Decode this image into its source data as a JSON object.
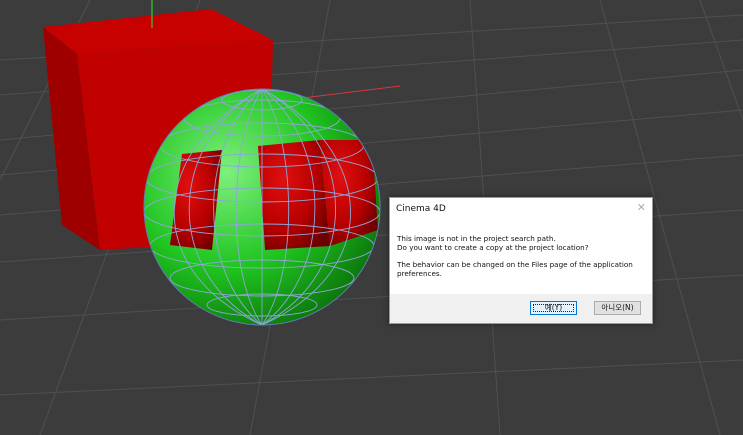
{
  "dialog": {
    "title": "Cinema 4D",
    "close_glyph": "✕",
    "line1": "This image is not in the project search path.",
    "line2": "Do you want to create a copy at the project location?",
    "line3": "The behavior can be changed on the Files page of the application",
    "line4": "preferences.",
    "yes_label": "예(Y)",
    "no_label": "아니오(N)"
  },
  "scene": {
    "background_color": "#3c3c3c",
    "cube_color": "#c10000",
    "sphere_green": "#1fc41f",
    "sphere_red": "#b80000",
    "wire_color": "#8fa6d8"
  }
}
